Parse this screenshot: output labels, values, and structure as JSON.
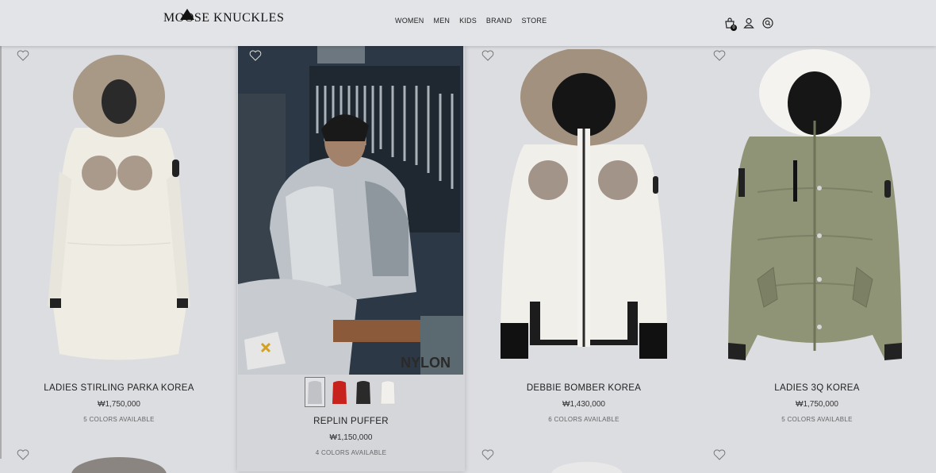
{
  "header": {
    "logo": "MOOSE KNUCKLES",
    "nav": [
      "WOMEN",
      "MEN",
      "KIDS",
      "BRAND",
      "STORE"
    ],
    "cart_count": "0"
  },
  "products": [
    {
      "name": "LADIES STIRLING PARKA KOREA",
      "price": "₩1,750,000",
      "colors": "5 COLORS AVAILABLE"
    },
    {
      "name": "REPLIN PUFFER",
      "price": "₩1,150,000",
      "colors": "4 COLORS AVAILABLE",
      "image_text": "NYLON"
    },
    {
      "name": "DEBBIE BOMBER KOREA",
      "price": "₩1,430,000",
      "colors": "6 COLORS AVAILABLE"
    },
    {
      "name": "LADIES 3Q KOREA",
      "price": "₩1,750,000",
      "colors": "5 COLORS AVAILABLE"
    }
  ],
  "swatch_colors": [
    "#c0c2c6",
    "#c8221c",
    "#2a2a2a",
    "#f1f0ec"
  ],
  "icons": [
    "heart-icon",
    "cart-icon",
    "user-icon",
    "search-icon"
  ]
}
